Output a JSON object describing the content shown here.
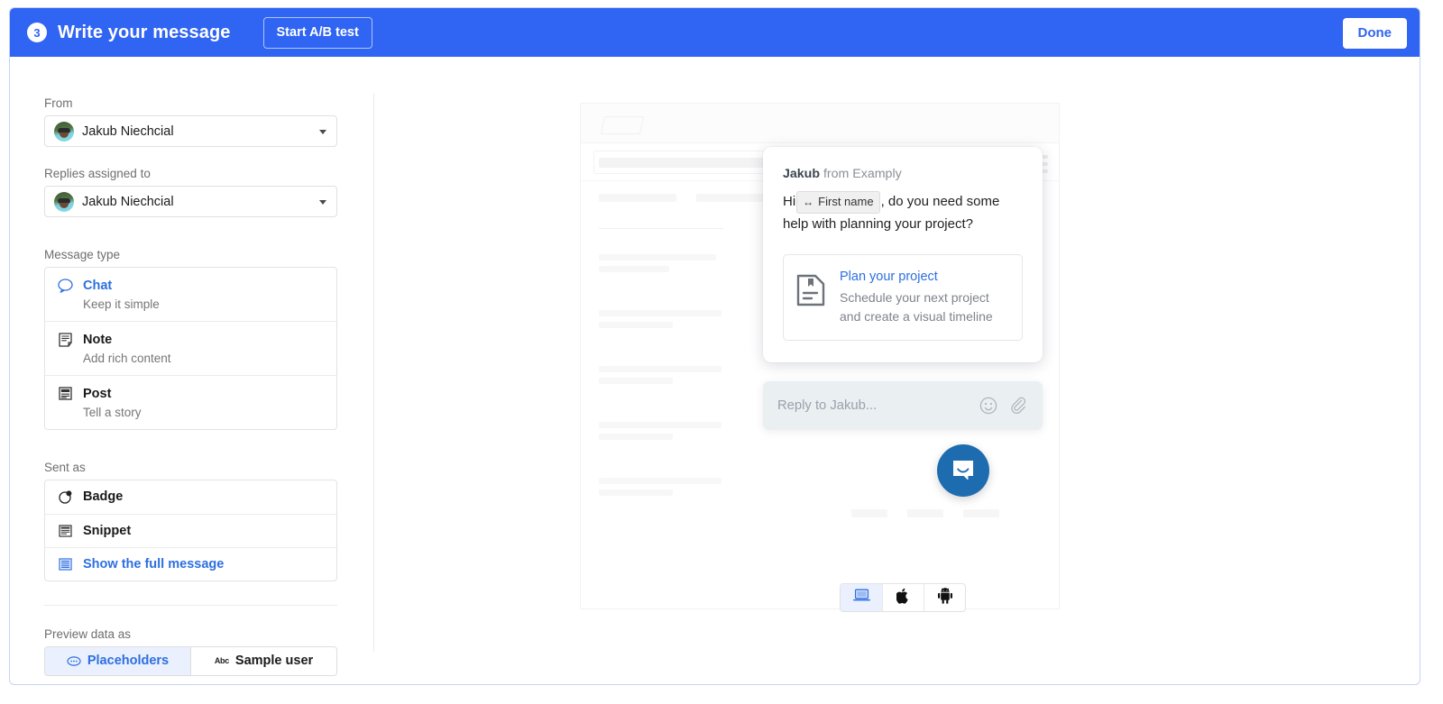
{
  "header": {
    "step_number": "3",
    "title": "Write your message",
    "ab_test_label": "Start A/B test",
    "done_label": "Done",
    "accent_color": "#3064f2"
  },
  "form": {
    "from": {
      "label": "From",
      "value": "Jakub Niechcial"
    },
    "replies_assigned_to": {
      "label": "Replies assigned to",
      "value": "Jakub Niechcial"
    },
    "message_type": {
      "label": "Message type",
      "options": [
        {
          "title": "Chat",
          "subtitle": "Keep it simple",
          "icon": "chat-bubble-icon",
          "selected": true
        },
        {
          "title": "Note",
          "subtitle": "Add rich content",
          "icon": "note-icon",
          "selected": false
        },
        {
          "title": "Post",
          "subtitle": "Tell a story",
          "icon": "post-icon",
          "selected": false
        }
      ]
    },
    "sent_as": {
      "label": "Sent as",
      "options": [
        {
          "title": "Badge",
          "icon": "badge-icon",
          "selected": false
        },
        {
          "title": "Snippet",
          "icon": "snippet-icon",
          "selected": false
        },
        {
          "title": "Show the full message",
          "icon": "full-message-icon",
          "selected": true
        }
      ]
    },
    "preview_data_as": {
      "label": "Preview data as",
      "options": [
        {
          "title": "Placeholders",
          "icon": "placeholder-icon",
          "selected": true
        },
        {
          "title": "Sample user",
          "icon": "abc-icon",
          "selected": false
        }
      ]
    }
  },
  "preview": {
    "message": {
      "sender_name": "Jakub",
      "sender_suffix": "from Examply",
      "text_before": "Hi",
      "placeholder_chip": "First name",
      "text_after": ", do you need some help with planning your project?",
      "article": {
        "title": "Plan your project",
        "subtitle": "Schedule your next project and create a visual timeline",
        "icon": "article-icon"
      }
    },
    "composer": {
      "placeholder": "Reply to Jakub...",
      "emoji_icon": "emoji-icon",
      "attach_icon": "paperclip-icon"
    },
    "launcher": {
      "icon": "messenger-launcher-icon",
      "color": "#1e6cb0"
    },
    "devices": [
      {
        "name": "desktop",
        "icon": "laptop-icon",
        "selected": true
      },
      {
        "name": "ios",
        "icon": "apple-icon",
        "selected": false
      },
      {
        "name": "android",
        "icon": "android-icon",
        "selected": false
      }
    ]
  }
}
